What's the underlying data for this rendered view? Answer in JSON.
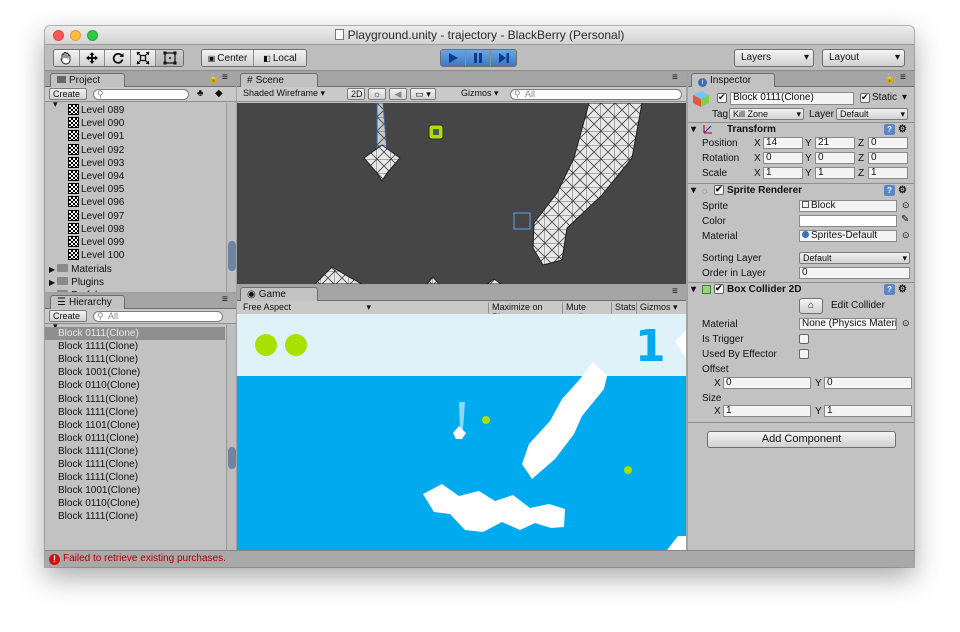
{
  "window": {
    "title": "Playground.unity - trajectory - BlackBerry (Personal)"
  },
  "toolbar": {
    "pivot_center": "Center",
    "pivot_local": "Local",
    "layers": "Layers",
    "layout": "Layout"
  },
  "project": {
    "tab": "Project",
    "create": "Create",
    "levels": [
      "Level 089",
      "Level 090",
      "Level 091",
      "Level 092",
      "Level 093",
      "Level 094",
      "Level 095",
      "Level 096",
      "Level 097",
      "Level 098",
      "Level 099",
      "Level 100"
    ],
    "folders": [
      "Materials",
      "Plugins",
      "Prefabs"
    ]
  },
  "hierarchy": {
    "tab": "Hierarchy",
    "create": "Create",
    "search_placeholder": "All",
    "items": [
      "Block 0111(Clone)",
      "Block 1111(Clone)",
      "Block 1111(Clone)",
      "Block 1001(Clone)",
      "Block 0110(Clone)",
      "Block 1111(Clone)",
      "Block 1111(Clone)",
      "Block 1101(Clone)",
      "Block 0111(Clone)",
      "Block 1111(Clone)",
      "Block 1111(Clone)",
      "Block 1111(Clone)",
      "Block 1001(Clone)",
      "Block 0110(Clone)",
      "Block 1111(Clone)"
    ]
  },
  "scene": {
    "tab": "Scene",
    "shading": "Shaded Wireframe",
    "mode_2d": "2D",
    "gizmos": "Gizmos",
    "search_placeholder": "All"
  },
  "game": {
    "tab": "Game",
    "aspect": "Free Aspect",
    "maximize": "Maximize on Play",
    "mute": "Mute audio",
    "stats": "Stats",
    "gizmos": "Gizmos",
    "score": "1"
  },
  "inspector": {
    "tab": "Inspector",
    "object_name": "Block 0111(Clone)",
    "static_label": "Static",
    "tag_label": "Tag",
    "tag_value": "Kill Zone",
    "layer_label": "Layer",
    "layer_value": "Default",
    "transform": {
      "title": "Transform",
      "rows": [
        {
          "label": "Position",
          "x": "14",
          "y": "21",
          "z": "0"
        },
        {
          "label": "Rotation",
          "x": "0",
          "y": "0",
          "z": "0"
        },
        {
          "label": "Scale",
          "x": "1",
          "y": "1",
          "z": "1"
        }
      ]
    },
    "sprite_renderer": {
      "title": "Sprite Renderer",
      "sprite_label": "Sprite",
      "sprite_value": "Block",
      "color_label": "Color",
      "material_label": "Material",
      "material_value": "Sprites-Default",
      "sorting_layer_label": "Sorting Layer",
      "sorting_layer_value": "Default",
      "order_label": "Order in Layer",
      "order_value": "0"
    },
    "box_collider": {
      "title": "Box Collider 2D",
      "edit_collider": "Edit Collider",
      "material_label": "Material",
      "material_value": "None (Physics Materia",
      "is_trigger_label": "Is Trigger",
      "used_by_effector_label": "Used By Effector",
      "offset_label": "Offset",
      "offset_x": "0",
      "offset_y": "0",
      "size_label": "Size",
      "size_x": "1",
      "size_y": "1"
    },
    "add_component": "Add Component"
  },
  "axis": {
    "x": "X",
    "y": "Y",
    "z": "Z"
  },
  "status": {
    "message": "Failed to retrieve existing purchases."
  },
  "colors": {
    "sky": "#dff2fa",
    "water": "#00aaee",
    "lime": "#a8e000",
    "score": "#00aaee",
    "error": "#c00000"
  },
  "icons": [
    "hand-icon",
    "move-icon",
    "rotate-icon",
    "scale-icon",
    "rect-icon",
    "play-icon",
    "pause-icon",
    "step-icon",
    "search-icon",
    "lock-icon",
    "menu-icon",
    "gear-icon",
    "help-icon",
    "cube-icon",
    "error-icon"
  ]
}
